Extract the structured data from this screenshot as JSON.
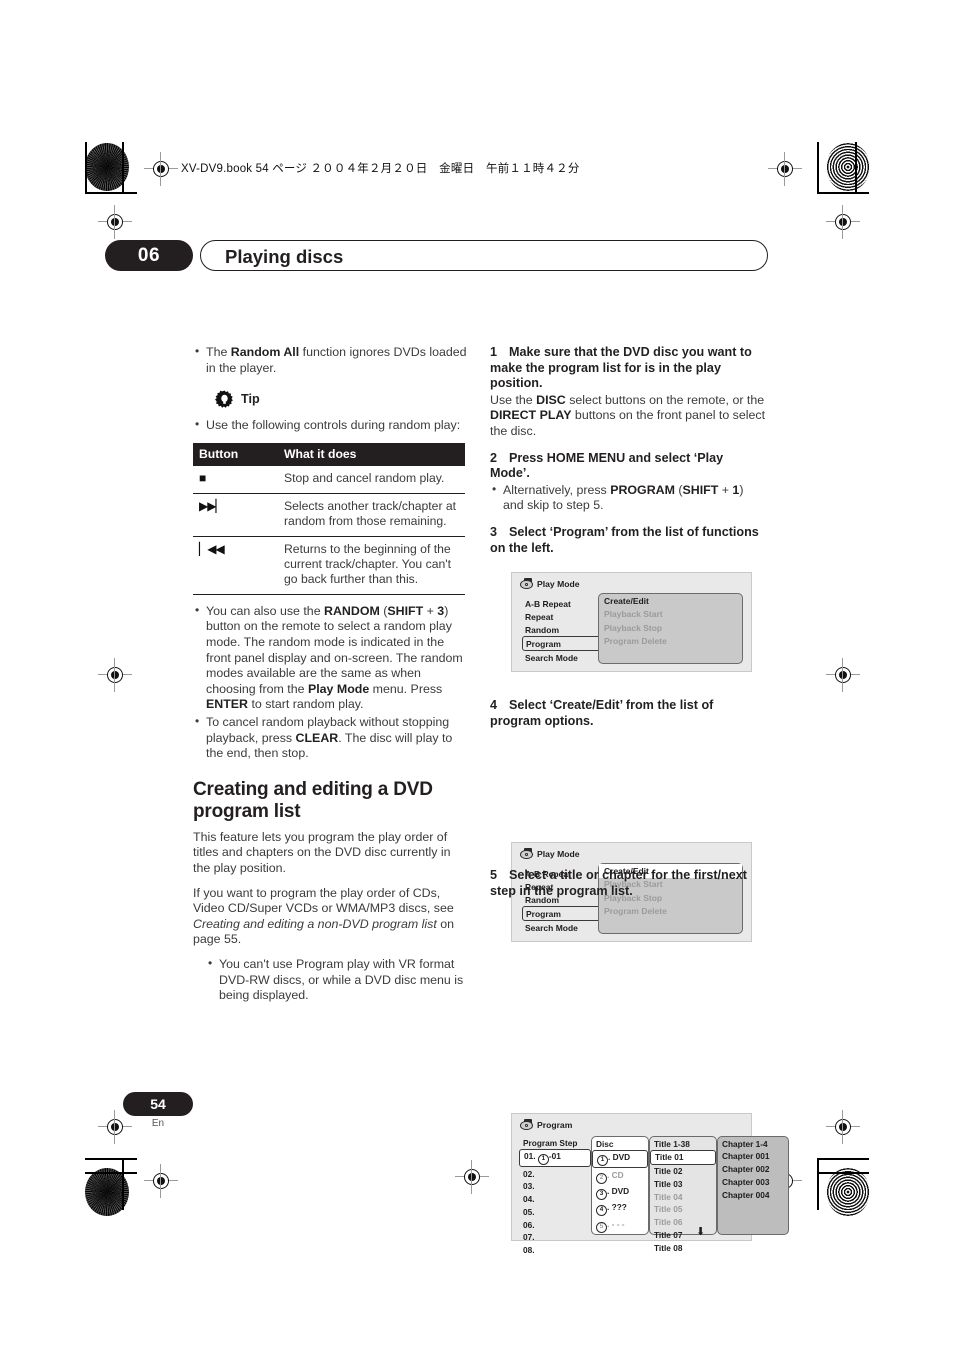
{
  "header": {
    "slug": "XV-DV9.book  54 ページ  ２００４年２月２０日　金曜日　午前１１時４２分",
    "chapter_number": "06",
    "chapter_title": "Playing discs"
  },
  "footer": {
    "page_number": "54",
    "language": "En"
  },
  "left_column": {
    "random_note": {
      "pre": "The ",
      "bold": "Random All",
      "post": " function ignores DVDs loaded in the player."
    },
    "tip": {
      "label": "Tip",
      "icon": "tip-bulb-icon"
    },
    "tip_bullet": "Use the following controls during random play:",
    "button_table": {
      "headers": [
        "Button",
        "What it does"
      ],
      "rows": [
        {
          "icon": "stop-icon",
          "glyph": "■",
          "desc": "Stop and cancel random play."
        },
        {
          "icon": "next-track-icon",
          "glyph": "▶▶▏",
          "desc": "Selects another track/chapter at random from those remaining."
        },
        {
          "icon": "previous-track-icon",
          "glyph": "▏◀◀",
          "desc": "Returns to the beginning of the current track/chapter. You can't go back further than this."
        }
      ]
    },
    "random_bullets": [
      {
        "parts": [
          {
            "t": "You can also use the ",
            "b": false
          },
          {
            "t": "RANDOM",
            "b": true
          },
          {
            "t": " (",
            "b": false
          },
          {
            "t": "SHIFT",
            "b": true
          },
          {
            "t": " + ",
            "b": false
          },
          {
            "t": "3",
            "b": true
          },
          {
            "t": ") button on the remote to select a random play mode. The random mode is indicated in the front panel display and on-screen. The random modes available are the same as when choosing from the ",
            "b": false
          },
          {
            "t": "Play Mode",
            "b": true
          },
          {
            "t": " menu. Press ",
            "b": false
          },
          {
            "t": "ENTER",
            "b": true
          },
          {
            "t": " to start random play.",
            "b": false
          }
        ]
      },
      {
        "parts": [
          {
            "t": "To cancel random playback without stopping playback, press ",
            "b": false
          },
          {
            "t": "CLEAR",
            "b": true
          },
          {
            "t": ". The disc will play to the end, then stop.",
            "b": false
          }
        ]
      }
    ],
    "section_heading": "Creating and editing a DVD program list",
    "section_para1": "This feature lets you program the play order of titles and chapters on the DVD disc currently in the play position.",
    "section_para2": {
      "pre": "If you want to program the play order of CDs, Video CD/Super VCDs or WMA/MP3 discs, see ",
      "italic": "Creating and editing a non-DVD program list",
      "post": " on page 55."
    },
    "section_bullet": "You can't use Program play with VR format DVD-RW discs, or while a DVD disc menu is being displayed."
  },
  "right_column": {
    "steps": [
      {
        "num": "1",
        "title": "Make sure that the DVD disc you want to make the program list for is in the play position.",
        "body_parts": [
          {
            "t": "Use the ",
            "b": false
          },
          {
            "t": "DISC",
            "b": true
          },
          {
            "t": " select buttons on the remote, or the ",
            "b": false
          },
          {
            "t": "DIRECT PLAY",
            "b": true
          },
          {
            "t": " buttons on the front panel to select the disc.",
            "b": false
          }
        ]
      },
      {
        "num": "2",
        "title": "Press HOME MENU and select ‘Play Mode’.",
        "bullet_parts": [
          {
            "t": "Alternatively, press ",
            "b": false
          },
          {
            "t": "PROGRAM",
            "b": true
          },
          {
            "t": " (",
            "b": false
          },
          {
            "t": "SHIFT",
            "b": true
          },
          {
            "t": " + ",
            "b": false
          },
          {
            "t": "1",
            "b": true
          },
          {
            "t": ") and skip to step 5.",
            "b": false
          }
        ]
      },
      {
        "num": "3",
        "title": "Select ‘Program’ from the list of functions on the left."
      },
      {
        "num": "4",
        "title": "Select ‘Create/Edit’ from the list of program options."
      },
      {
        "num": "5",
        "title": "Select a title or chapter for the first/next step in the program list."
      }
    ]
  },
  "figures": {
    "play_mode_1": {
      "title": "Play Mode",
      "icon": "disc-menu-icon",
      "menu_items": [
        "A-B Repeat",
        "Repeat",
        "Random",
        "Program",
        "Search Mode"
      ],
      "selected_menu": "Program",
      "options": [
        {
          "label": "Create/Edit",
          "state": "enabled"
        },
        {
          "label": "Playback Start",
          "state": "disabled"
        },
        {
          "label": "Playback Stop",
          "state": "disabled"
        },
        {
          "label": "Program Delete",
          "state": "disabled"
        }
      ],
      "highlighted_option": ""
    },
    "play_mode_2": {
      "title": "Play Mode",
      "icon": "disc-menu-icon",
      "menu_items": [
        "A-B Repeat",
        "Repeat",
        "Random",
        "Program",
        "Search Mode"
      ],
      "selected_menu": "Program",
      "options": [
        {
          "label": "Create/Edit",
          "state": "enabled"
        },
        {
          "label": "Playback Start",
          "state": "disabled"
        },
        {
          "label": "Playback Stop",
          "state": "disabled"
        },
        {
          "label": "Program Delete",
          "state": "disabled"
        }
      ],
      "highlighted_option": "Create/Edit"
    },
    "program": {
      "title": "Program",
      "icon": "disc-menu-icon",
      "columns": [
        "Program Step",
        "Disc",
        "Title 1-38",
        "Chapter 1-4"
      ],
      "program_steps": [
        {
          "label": "01.",
          "value": "-01",
          "disc_num": "1",
          "selected": true
        },
        {
          "label": "02.",
          "value": "",
          "disc_num": "",
          "selected": false
        },
        {
          "label": "03.",
          "value": "",
          "disc_num": "",
          "selected": false
        },
        {
          "label": "04.",
          "value": "",
          "disc_num": "",
          "selected": false
        },
        {
          "label": "05.",
          "value": "",
          "disc_num": "",
          "selected": false
        },
        {
          "label": "06.",
          "value": "",
          "disc_num": "",
          "selected": false
        },
        {
          "label": "07.",
          "value": "",
          "disc_num": "",
          "selected": false
        },
        {
          "label": "08.",
          "value": "",
          "disc_num": "",
          "selected": false
        }
      ],
      "discs": [
        {
          "num": "1",
          "label": "DVD",
          "state": "enabled",
          "selected": true
        },
        {
          "num": "2",
          "label": "CD",
          "state": "disabled",
          "selected": false
        },
        {
          "num": "3",
          "label": "DVD",
          "state": "enabled",
          "selected": false
        },
        {
          "num": "4",
          "label": "???",
          "state": "enabled",
          "selected": false
        },
        {
          "num": "5",
          "label": "- - -",
          "state": "disabled",
          "selected": false
        }
      ],
      "titles": [
        {
          "label": "Title 01",
          "state": "enabled",
          "selected": true
        },
        {
          "label": "Title 02",
          "state": "enabled",
          "selected": false
        },
        {
          "label": "Title 03",
          "state": "enabled",
          "selected": false
        },
        {
          "label": "Title 04",
          "state": "disabled",
          "selected": false
        },
        {
          "label": "Title 05",
          "state": "disabled",
          "selected": false
        },
        {
          "label": "Title 06",
          "state": "disabled",
          "selected": false
        },
        {
          "label": "Title 07",
          "state": "enabled",
          "selected": false
        },
        {
          "label": "Title 08",
          "state": "enabled",
          "selected": false
        }
      ],
      "scroll_indicator": "⬇",
      "chapters": [
        "Chapter 001",
        "Chapter 002",
        "Chapter 003",
        "Chapter 004"
      ]
    }
  }
}
